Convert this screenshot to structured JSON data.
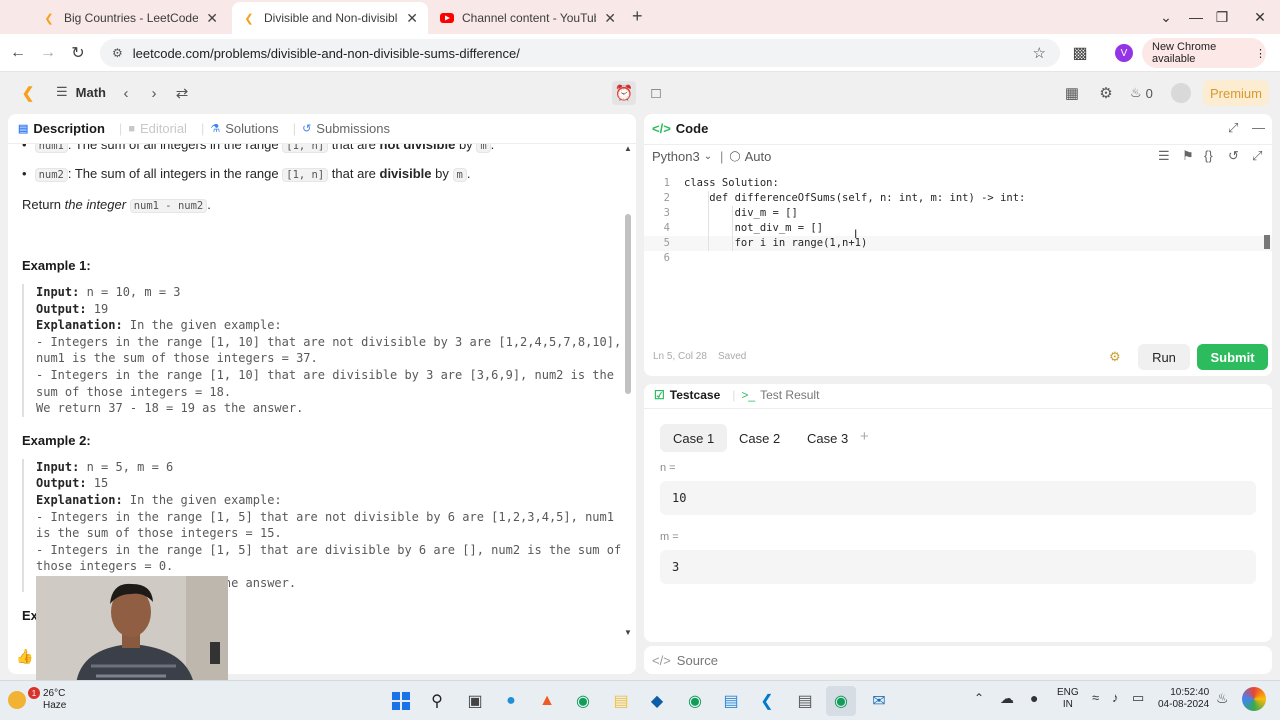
{
  "browser": {
    "tabs": [
      {
        "title": "Big Countries - LeetCode",
        "active": false,
        "icon": "leetcode-icon"
      },
      {
        "title": "Divisible and Non-divisible Sum",
        "active": true,
        "icon": "leetcode-icon"
      },
      {
        "title": "Channel content - YouTube Stu",
        "active": false,
        "icon": "youtube-icon"
      }
    ],
    "url": "leetcode.com/problems/divisible-and-non-divisible-sums-difference/",
    "new_chrome": "New Chrome available",
    "profile_initial": "V"
  },
  "lc_header": {
    "list_name": "Math",
    "streak": "0",
    "premium": "Premium"
  },
  "left_tabs": [
    {
      "label": "Description",
      "icon": "description-icon",
      "state": "active"
    },
    {
      "label": "Editorial",
      "icon": "editorial-icon",
      "state": "disabled"
    },
    {
      "label": "Solutions",
      "icon": "solutions-icon",
      "state": "normal"
    },
    {
      "label": "Submissions",
      "icon": "submissions-icon",
      "state": "normal"
    }
  ],
  "description": {
    "bullet1_code": "num1",
    "bullet1_pre": ": The sum of all integers in the range ",
    "bullet1_range": "[1, n]",
    "bullet1_mid": " that are ",
    "bullet1_bold": "not divisible",
    "bullet1_by": " by ",
    "bullet1_m": "m",
    "bullet1_end": ".",
    "bullet2_code": "num2",
    "bullet2_pre": ": The sum of all integers in the range ",
    "bullet2_range": "[1, n]",
    "bullet2_mid": " that are ",
    "bullet2_bold": "divisible",
    "bullet2_by": " by ",
    "bullet2_m": "m",
    "bullet2_end": ".",
    "return_pre": "Return ",
    "return_em": "the integer",
    "return_code": "num1 - num2",
    "return_end": ".",
    "example1": {
      "heading": "Example 1:",
      "input_label": "Input:",
      "input": " n = 10, m = 3",
      "output_label": "Output:",
      "output": " 19",
      "explanation_label": "Explanation:",
      "explanation": " In the given example:\n- Integers in the range [1, 10] that are not divisible by 3 are [1,2,4,5,7,8,10], num1 is the sum of those integers = 37.\n- Integers in the range [1, 10] that are divisible by 3 are [3,6,9], num2 is the sum of those integers = 18.\nWe return 37 - 18 = 19 as the answer."
    },
    "example2": {
      "heading": "Example 2:",
      "input_label": "Input:",
      "input": " n = 5, m = 6",
      "output_label": "Output:",
      "output": " 15",
      "explanation_label": "Explanation:",
      "explanation": " In the given example:\n- Integers in the range [1, 5] that are not divisible by 6 are [1,2,3,4,5], num1 is the sum of those integers = 15.\n- Integers in the range [1, 5] that are divisible by 6 are [], num2 is the sum of those integers = 0.\nWe return 15 - 0 = 15 as the answer."
    },
    "example3_heading": "Exa"
  },
  "code_panel": {
    "title": "Code",
    "language": "Python3",
    "mode": "Auto",
    "lines": [
      {
        "n": "1",
        "text": "class Solution:"
      },
      {
        "n": "2",
        "text": "    def differenceOfSums(self, n: int, m: int) -> int:"
      },
      {
        "n": "3",
        "text": "        div_m = []"
      },
      {
        "n": "4",
        "text": "        not_div_m = []"
      },
      {
        "n": "5",
        "text": "        for i in range(1,n+1)"
      },
      {
        "n": "6",
        "text": ""
      }
    ],
    "status_pos": "Ln 5, Col 28",
    "status_saved": "Saved",
    "run": "Run",
    "submit": "Submit"
  },
  "test_panel": {
    "tab_testcase": "Testcase",
    "tab_result": "Test Result",
    "cases": [
      "Case 1",
      "Case 2",
      "Case 3"
    ],
    "var1_label": "n =",
    "var1_value": "10",
    "var2_label": "m =",
    "var2_value": "3"
  },
  "source_label": "Source",
  "taskbar": {
    "weather_temp": "26°C",
    "weather_desc": "Haze",
    "weather_badge": "1",
    "lang1": "ENG",
    "lang2": "IN",
    "time": "10:52:40",
    "date": "04-08-2024"
  },
  "colors": {
    "accent_green": "#2cbb5d",
    "premium_orange": "#d99a2b",
    "tab_bar_pink": "#f8e8e8"
  }
}
